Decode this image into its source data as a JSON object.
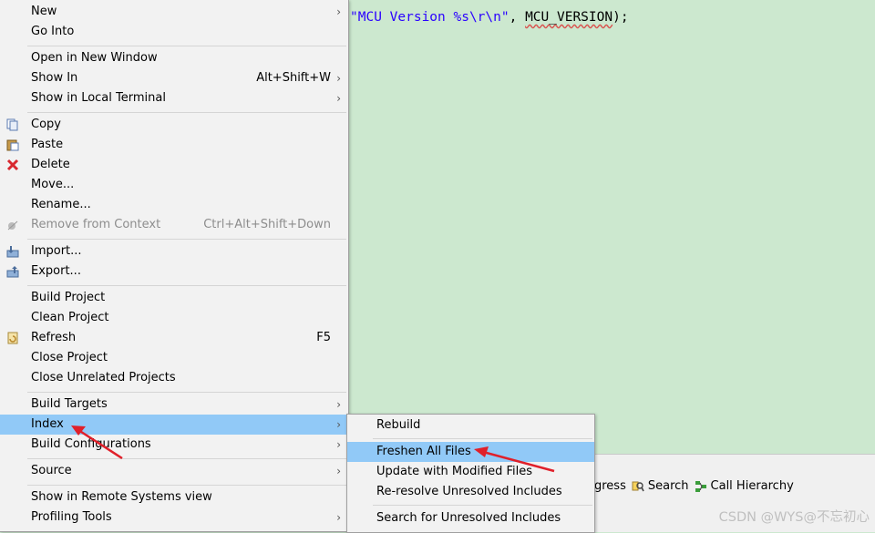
{
  "editor": {
    "code_str": "\"MCU Version %s\\r\\n\"",
    "code_mid": ", ",
    "code_macro": "MCU_VERSION",
    "code_end": ");"
  },
  "bottom_tabs": {
    "progress_fragment": "gress",
    "search": "Search",
    "call_hierarchy": "Call Hierarchy"
  },
  "watermark": "CSDN @WYS@不忘初心",
  "main_menu": {
    "new": "New",
    "go_into": "Go Into",
    "open_new_window": "Open in New Window",
    "show_in": "Show In",
    "show_in_acc": "Alt+Shift+W",
    "show_local_terminal": "Show in Local Terminal",
    "copy": "Copy",
    "paste": "Paste",
    "delete": "Delete",
    "move": "Move...",
    "rename": "Rename...",
    "remove_context": "Remove from Context",
    "remove_context_acc": "Ctrl+Alt+Shift+Down",
    "import": "Import...",
    "export": "Export...",
    "build_project": "Build Project",
    "clean_project": "Clean Project",
    "refresh": "Refresh",
    "refresh_acc": "F5",
    "close_project": "Close Project",
    "close_unrelated": "Close Unrelated Projects",
    "build_targets": "Build Targets",
    "index": "Index",
    "build_configs": "Build Configurations",
    "source": "Source",
    "show_remote": "Show in Remote Systems view",
    "profiling_tools": "Profiling Tools"
  },
  "sub_menu": {
    "rebuild": "Rebuild",
    "freshen": "Freshen All Files",
    "update_modified": "Update with Modified Files",
    "reresolve": "Re-resolve Unresolved Includes",
    "search_unresolved": "Search for Unresolved Includes"
  },
  "colors": {
    "editor_bg": "#cce8cf",
    "menu_bg": "#f2f2f2",
    "highlight": "#91c9f7",
    "annotation_arrow": "#e0202a"
  }
}
